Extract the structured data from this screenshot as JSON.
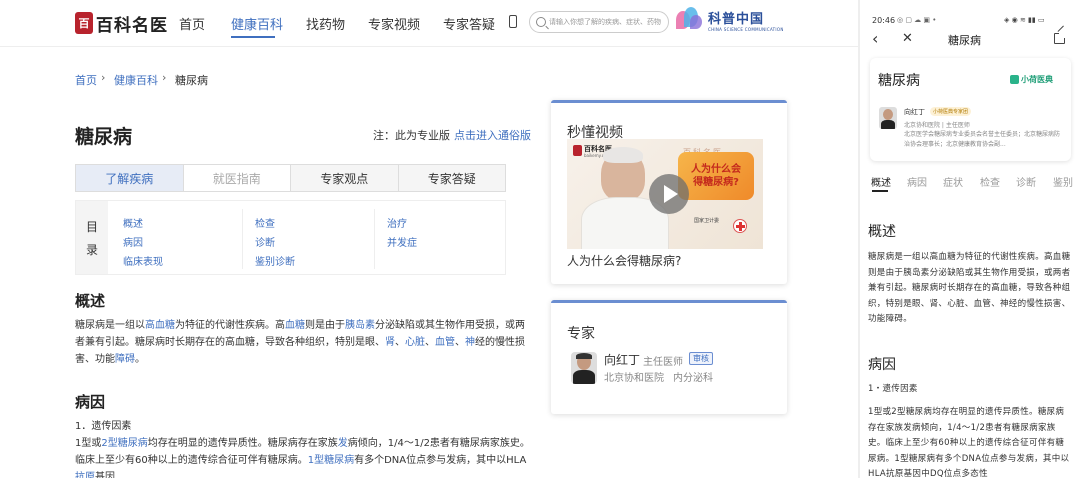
{
  "desktop": {
    "logo": {
      "seal": "百",
      "text": "百科名医"
    },
    "nav": [
      "首页",
      "健康百科",
      "找药物",
      "专家视频",
      "专家答疑"
    ],
    "nav_active_index": 1,
    "search_placeholder": "请输入你想了解的疾病、症状、药物",
    "partner_logo": {
      "cn": "科普中国",
      "en": "CHINA SCIENCE COMMUNICATION"
    },
    "breadcrumb": [
      "首页",
      "健康百科",
      "糖尿病"
    ],
    "page_title": "糖尿病",
    "pro_note": "注：此为专业版",
    "pro_link": "点击进入通俗版",
    "tabs": [
      "了解疾病",
      "就医指南",
      "专家观点",
      "专家答疑"
    ],
    "toc": {
      "label_chars": [
        "目",
        "录"
      ],
      "col1": [
        "概述",
        "病因",
        "临床表现"
      ],
      "col2": [
        "检查",
        "诊断",
        "鉴别诊断"
      ],
      "col3": [
        "治疗",
        "并发症"
      ]
    },
    "overview": {
      "heading": "概述",
      "p1_a": "糖尿病是一组以",
      "p1_l1": "高血糖",
      "p1_b": "为特征的代谢性疾病。高",
      "p1_l2": "血糖",
      "p1_c": "则是由于",
      "p1_l3": "胰岛素",
      "p1_d": "分泌缺陷或其生物作用受损，或两者兼有引起。糖尿病时长期存在的高血糖，导致各种组织，特别是眼、",
      "p1_l4": "肾",
      "p1_e": "、",
      "p1_l5": "心脏",
      "p1_f": "、",
      "p1_l6": "血管",
      "p1_g": "、",
      "p1_l7": "神",
      "p1_h": "经的慢性损害、功能",
      "p1_l8": "障碍",
      "p1_i": "。"
    },
    "cause": {
      "heading": "病因",
      "sub": "1．遗传因素",
      "p_a": "1型或",
      "p_l1": "2型糖尿病",
      "p_b": "均存在明显的遗传异质性。糖尿病存在家族",
      "p_l2": "发",
      "p_c": "病倾向，1/4～1/2患者有糖尿病家族史。临床上至少有60种以上的遗传综合征可伴有糖尿病。",
      "p_l3": "1型糖尿病",
      "p_d": "有多个DNA位点参与发病，其中以HLA",
      "p_l4": "抗原",
      "p_e": "基因"
    },
    "video_card": {
      "title": "秒懂视频",
      "thumb_logo": "百科名医",
      "thumb_domain": "baikemy.com",
      "thumb_watermark": "百科名医",
      "bubble_lines": [
        "人为什么会",
        "得糖尿病?"
      ],
      "thumb_org": "国家卫计委",
      "caption": "人为什么会得糖尿病?"
    },
    "expert_card": {
      "title": "专家",
      "name": "向红丁",
      "role": "主任医师",
      "badge": "审核",
      "affiliation": "北京协和医院",
      "department": "内分泌科"
    }
  },
  "mobile": {
    "status_time": "20:46",
    "status_icons": "◎ ▢ ☁ ▣ •",
    "status_right": "◈ ◉ ≋ ▮▮ ▭",
    "nav_title": "糖尿病",
    "card": {
      "title": "糖尿病",
      "brand": "小荷医典",
      "expert_name": "向红丁",
      "expert_badge": "小荷医典专家团",
      "expert_line": "北京协和医院 | 主任医师",
      "expert_bio": "北京医学会糖尿病专业委员会名誉主任委员；北京糖尿病防治协会理事长；北京健康教育协会副..."
    },
    "tabs": [
      "概述",
      "病因",
      "症状",
      "检查",
      "诊断",
      "鉴别"
    ],
    "tab_active_index": 0,
    "overview_heading": "概述",
    "overview_text": "糖尿病是一组以高血糖为特征的代谢性疾病。高血糖则是由于胰岛素分泌缺陷或其生物作用受损，或两者兼有引起。糖尿病时长期存在的高血糖，导致各种组织，特别是眼、肾、心脏、血管、神经的慢性损害、功能障碍。",
    "cause_heading": "病因",
    "cause_sub": "1・遗传因素",
    "cause_text": "1型或2型糖尿病均存在明显的遗传异质性。糖尿病存在家族发病倾向，1/4～1/2患者有糖尿病家族史。临床上至少有60种以上的遗传综合征可伴有糖尿病。1型糖尿病有多个DNA位点参与发病，其中以HLA抗原基因中DQ位点多态性"
  }
}
